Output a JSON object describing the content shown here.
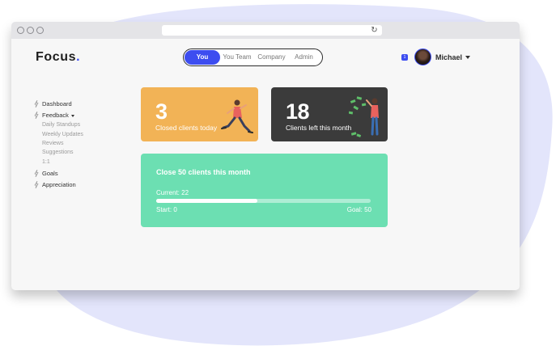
{
  "app": {
    "logo": "Focus",
    "logo_dot": "."
  },
  "header": {
    "tabs": [
      {
        "label": "You",
        "active": true
      },
      {
        "label": "You Team",
        "active": false
      },
      {
        "label": "Company",
        "active": false
      },
      {
        "label": "Admin",
        "active": false
      }
    ],
    "notification_count": "1",
    "user_name": "Michael"
  },
  "sidebar": {
    "items": [
      {
        "label": "Dashboard",
        "icon": "bolt-icon"
      },
      {
        "label": "Feedback",
        "icon": "bolt-icon",
        "expanded": true,
        "children": [
          "Daily Standups",
          "Weekly Updates",
          "Reviews",
          "Suggestions",
          "1:1"
        ]
      },
      {
        "label": "Goals",
        "icon": "bolt-icon"
      },
      {
        "label": "Appreciation",
        "icon": "bolt-icon"
      }
    ]
  },
  "stats": [
    {
      "value": "3",
      "caption": "Closed clients today",
      "color": "#f2b356"
    },
    {
      "value": "18",
      "caption": "Clients left this month",
      "color": "#3b3b3b"
    }
  ],
  "goal": {
    "title": "Close 50 clients this month",
    "current_text": "Current: 22",
    "start_text": "Start: 0",
    "goal_text": "Goal: 50",
    "progress": 0.47,
    "color": "#6cdfb2"
  },
  "colors": {
    "accent": "#3d4df0",
    "blob": "#e3e5fb"
  }
}
